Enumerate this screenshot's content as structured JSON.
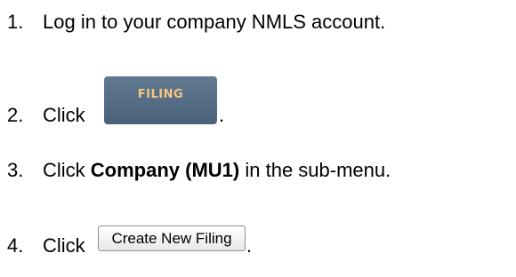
{
  "steps": [
    {
      "number": "1.",
      "text": "Log in to your company NMLS account."
    },
    {
      "number": "2.",
      "text_before": "Click",
      "button_label": "FILING",
      "text_after": "."
    },
    {
      "number": "3.",
      "text_before": "Click",
      "bold_text": "Company (MU1)",
      "text_after": "in the sub-menu."
    },
    {
      "number": "4.",
      "text_before": "Click",
      "button_label": "Create New Filing",
      "text_after": "."
    }
  ],
  "colors": {
    "filing_button_bg": "#566e85",
    "filing_button_text": "#f5c781",
    "create_button_border": "#8d8d8d"
  }
}
